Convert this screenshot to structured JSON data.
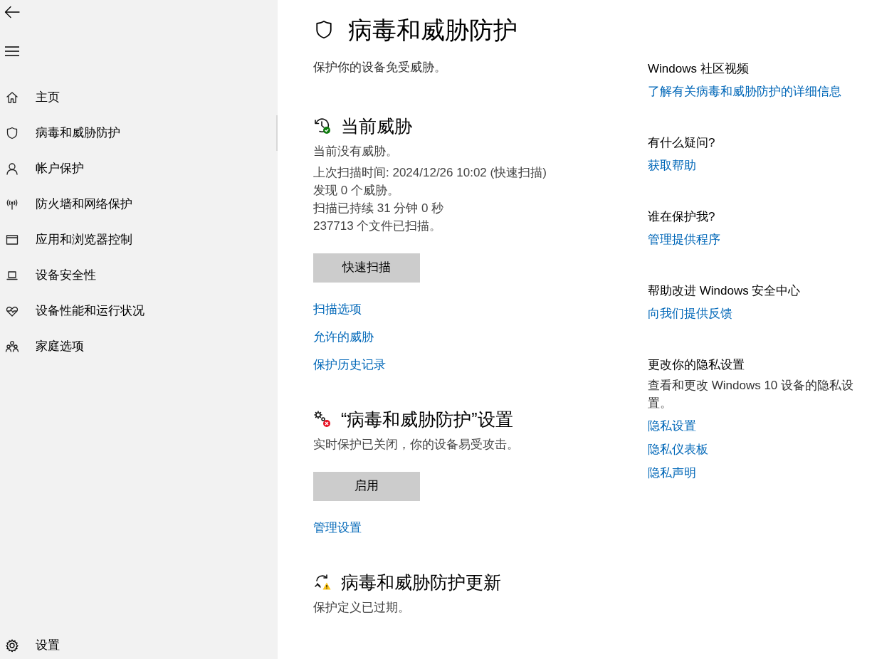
{
  "sidebar": {
    "items": [
      {
        "label": "主页",
        "selected": false
      },
      {
        "label": "病毒和威胁防护",
        "selected": true
      },
      {
        "label": "帐户保护",
        "selected": false
      },
      {
        "label": "防火墙和网络保护",
        "selected": false
      },
      {
        "label": "应用和浏览器控制",
        "selected": false
      },
      {
        "label": "设备安全性",
        "selected": false
      },
      {
        "label": "设备性能和运行状况",
        "selected": false
      },
      {
        "label": "家庭选项",
        "selected": false
      }
    ],
    "settings": {
      "label": "设置"
    }
  },
  "page": {
    "title": "病毒和威胁防护",
    "subtitle": "保护你的设备免受威胁。"
  },
  "sections": [
    {
      "kind": "threats",
      "title": "当前威胁",
      "lines": [
        "当前没有威胁。",
        "上次扫描时间: 2024/12/26 10:02 (快速扫描)",
        "发现 0 个威胁。",
        "扫描已持续 31 分钟 0 秒",
        "237713 个文件已扫描。"
      ],
      "button": "快速扫描",
      "links": [
        "扫描选项",
        "允许的威胁",
        "保护历史记录"
      ]
    },
    {
      "kind": "settings",
      "title": "“病毒和威胁防护”设置",
      "lines": [
        "实时保护已关闭，你的设备易受攻击。"
      ],
      "button": "启用",
      "links": [
        "管理设置"
      ]
    },
    {
      "kind": "updates",
      "title": "病毒和威胁防护更新",
      "lines": [
        "保护定义已过期。"
      ]
    }
  ],
  "aside": [
    {
      "heading": "Windows 社区视频",
      "links": [
        "了解有关病毒和威胁防护的详细信息"
      ]
    },
    {
      "heading": "有什么疑问?",
      "links": [
        "获取帮助"
      ]
    },
    {
      "heading": "谁在保护我?",
      "links": [
        "管理提供程序"
      ]
    },
    {
      "heading": "帮助改进 Windows 安全中心",
      "links": [
        "向我们提供反馈"
      ]
    },
    {
      "heading": "更改你的隐私设置",
      "text": "查看和更改 Windows 10 设备的隐私设置。",
      "links": [
        "隐私设置",
        "隐私仪表板",
        "隐私声明"
      ]
    }
  ]
}
